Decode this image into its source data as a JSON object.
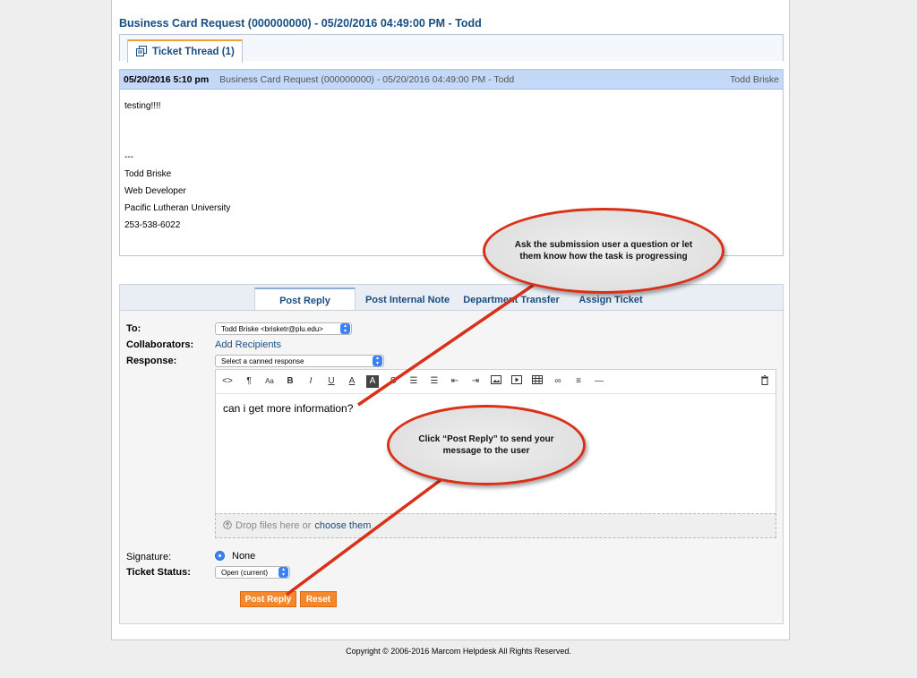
{
  "ticket": {
    "title": "Business Card Request (000000000) - 05/20/2016 04:49:00 PM - Todd",
    "thread_tab_label": "Ticket Thread (1)"
  },
  "thread_entry": {
    "date": "05/20/2016 5:10 pm",
    "subject": "Business Card Request (000000000) - 05/20/2016 04:49:00 PM - Todd",
    "poster": "Todd Briske",
    "body_lines": [
      "testing!!!!",
      "",
      "",
      "---",
      "Todd Briske",
      "Web Developer",
      "Pacific Lutheran University",
      "253-538-6022"
    ]
  },
  "reply_tabs": [
    "Post Reply",
    "Post Internal Note",
    "Department Transfer",
    "Assign Ticket"
  ],
  "form": {
    "to_label": "To:",
    "to_value": "Todd Briske <brisketr@plu.edu>",
    "collaborators_label": "Collaborators:",
    "add_recipients": "Add Recipients",
    "response_label": "Response:",
    "canned_response": "Select a canned response",
    "editor_text": "can i get more information?",
    "dropzone_text": "Drop files here or",
    "dropzone_link": "choose them",
    "signature_label": "Signature:",
    "signature_value": "None",
    "status_label": "Ticket Status:",
    "status_value": "Open (current)",
    "post_reply_button": "Post Reply",
    "reset_button": "Reset"
  },
  "toolbar_icons": [
    "code-icon",
    "paragraph-icon",
    "font-size-icon",
    "bold-icon",
    "italic-icon",
    "underline-icon",
    "font-color-icon",
    "background-color-icon",
    "strikethrough-icon",
    "unordered-list-icon",
    "ordered-list-icon",
    "outdent-icon",
    "indent-icon",
    "image-icon",
    "video-icon",
    "table-icon",
    "link-icon",
    "align-icon",
    "horizontal-rule-icon",
    "trash-icon"
  ],
  "callouts": {
    "top": "Ask the submission user a question or let them know how the task is progressing",
    "bottom": "Click “Post Reply” to send your message to the user"
  },
  "footer": "Copyright © 2006-2016 Marcom Helpdesk All Rights Reserved.",
  "colors": {
    "link_blue": "#184e81",
    "header_blue": "#c4d8f7",
    "button_orange": "#f5882a",
    "callout_border": "#d93018"
  }
}
